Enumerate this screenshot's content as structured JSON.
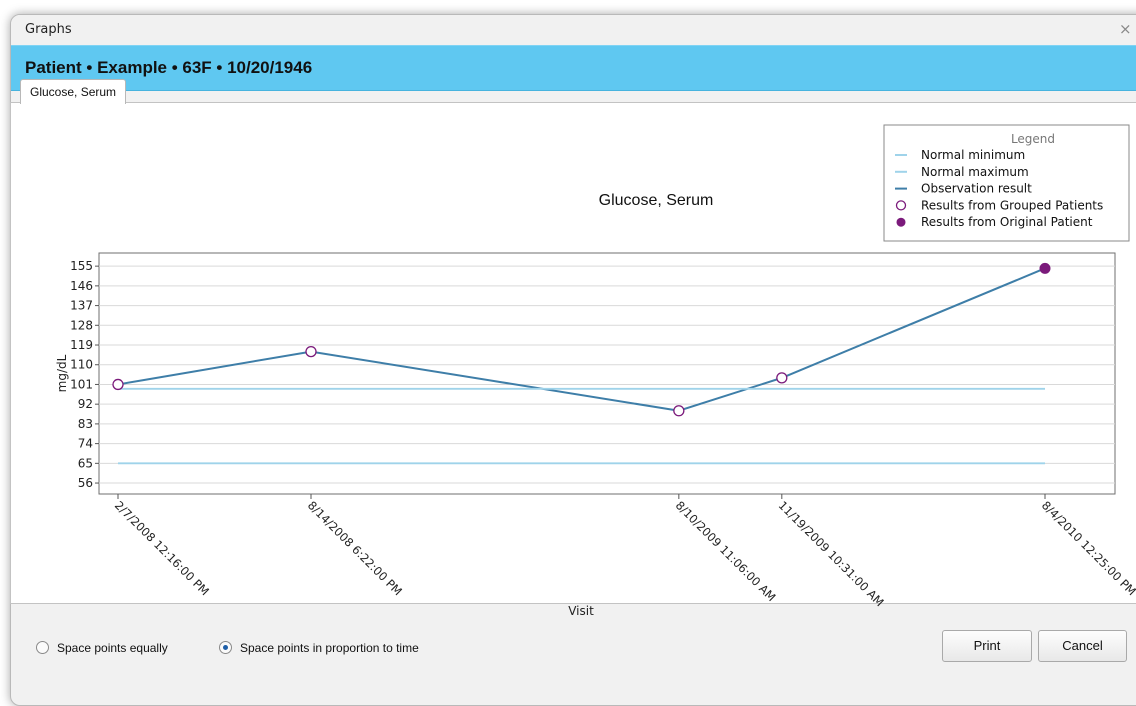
{
  "window": {
    "title": "Graphs",
    "close_glyph": "×"
  },
  "patient": {
    "header": "Patient • Example • 63F • 10/20/1946"
  },
  "tabs": [
    {
      "label": "Glucose, Serum"
    }
  ],
  "chart_data": {
    "type": "line",
    "title": "Glucose, Serum",
    "xlabel": "Visit",
    "ylabel": "mg/dL",
    "x": [
      "2/7/2008 12:16:00 PM",
      "8/14/2008 6:22:00 PM",
      "8/10/2009 11:06:00 AM",
      "11/19/2009 10:31:00 AM",
      "8/4/2010 12:25:00 PM"
    ],
    "x_dates": [
      "2008-02-07T12:16",
      "2008-08-14T18:22",
      "2009-08-10T11:06",
      "2009-11-19T10:31",
      "2010-08-04T12:25"
    ],
    "y_ticks": [
      56,
      65,
      74,
      83,
      92,
      101,
      110,
      119,
      128,
      137,
      146,
      155
    ],
    "ylim": [
      51,
      161
    ],
    "grid": true,
    "series": [
      {
        "name": "Observation result",
        "values": [
          101,
          116,
          89,
          104,
          154
        ],
        "color": "#3e7ea8"
      },
      {
        "name": "Normal minimum",
        "values": [
          65,
          65,
          65,
          65,
          65
        ],
        "color": "#9fd3ea"
      },
      {
        "name": "Normal maximum",
        "values": [
          99,
          99,
          99,
          99,
          99
        ],
        "color": "#9fd3ea"
      }
    ],
    "point_groups": {
      "grouped": [
        0,
        1,
        2,
        3
      ],
      "original": [
        4
      ]
    },
    "marker_color": "#7b1a7b",
    "legend": {
      "title": "Legend",
      "position": "top-right",
      "items": [
        {
          "label": "Normal minimum",
          "kind": "line"
        },
        {
          "label": "Normal maximum",
          "kind": "line"
        },
        {
          "label": "Observation result",
          "kind": "line-dark"
        },
        {
          "label": "Results from Grouped Patients",
          "kind": "open-circle"
        },
        {
          "label": "Results from Original Patient",
          "kind": "filled-circle"
        }
      ]
    }
  },
  "footer": {
    "radio_equal": "Space points equally",
    "radio_proportional": "Space points in proportion to time",
    "selected": "proportional",
    "print": "Print",
    "cancel": "Cancel"
  }
}
